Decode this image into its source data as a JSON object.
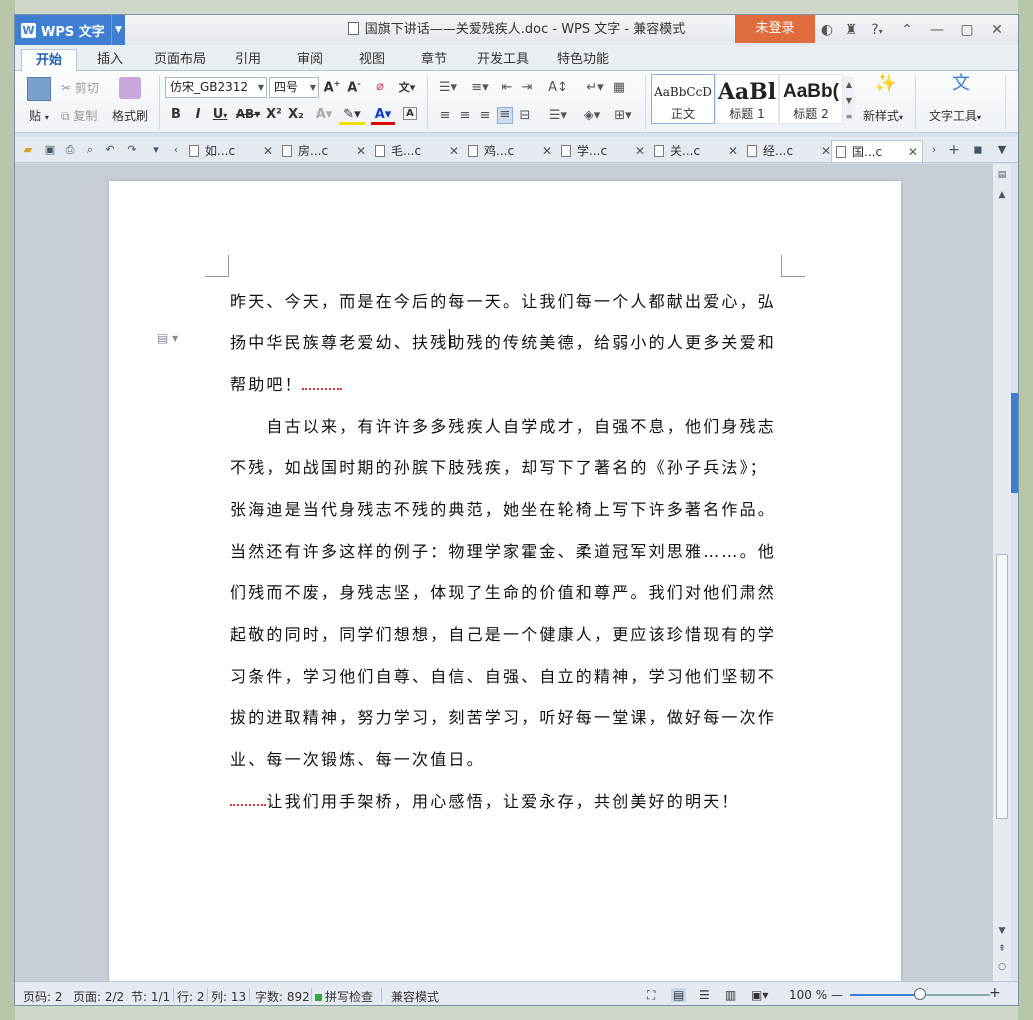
{
  "window": {
    "app_menu_label": "WPS 文字",
    "doc_title": "国旗下讲话——关爱残疾人.doc - WPS 文字 - 兼容模式",
    "login_label": "未登录",
    "help_label": "?"
  },
  "ribbon_tabs": [
    "开始",
    "插入",
    "页面布局",
    "引用",
    "审阅",
    "视图",
    "章节",
    "开发工具",
    "特色功能"
  ],
  "ribbon": {
    "paste_label": "贴",
    "cut_label": "剪切",
    "copy_label": "复制",
    "format_painter_label": "格式刷",
    "font_name": "仿宋_GB2312",
    "font_size": "四号",
    "styles": [
      {
        "sample": "AaBbCcD",
        "name": "正文"
      },
      {
        "sample": "AaBl",
        "name": "标题 1"
      },
      {
        "sample": "AaBb(",
        "name": "标题 2"
      }
    ],
    "new_style_label": "新样式",
    "text_tools_label": "文字工具"
  },
  "doc_tabs": [
    {
      "label": "如...c"
    },
    {
      "label": "房...c"
    },
    {
      "label": "毛...c"
    },
    {
      "label": "鸡...c"
    },
    {
      "label": "学...c"
    },
    {
      "label": "关...c"
    },
    {
      "label": "经...c"
    },
    {
      "label": "国...c"
    }
  ],
  "document": {
    "lines": [
      "昨天、今天，而是在今后的每一天。让我们每一个人都献出爱心，弘",
      "扬中华民族尊老爱幼、扶残助残的传统美德，给弱小的人更多关爱和",
      "帮助吧！",
      "　　自古以来，有许许多多残疾人自学成才，自强不息，他们身残志",
      "不残，如战国时期的孙膑下肢残疾，却写下了著名的《孙子兵法》；",
      "张海迪是当代身残志不残的典范，她坐在轮椅上写下许多著名作品。",
      "当然还有许多这样的例子：物理学家霍金、柔道冠军刘思雅……。他",
      "们残而不废，身残志坚，体现了生命的价值和尊严。我们对他们肃然",
      "起敬的同时，同学们想想，自己是一个健康人，更应该珍惜现有的学",
      "习条件，学习他们自尊、自信、自强、自立的精神，学习他们坚韧不",
      "拔的进取精神，努力学习，刻苦学习，听好每一堂课，做好每一次作",
      "业、每一次锻炼、每一次值日。",
      "　　让我们用手架桥，用心感悟，让爱永存，共创美好的明天！"
    ]
  },
  "status": {
    "page_code": "页码: 2",
    "page": "页面: 2/2",
    "section": "节: 1/1",
    "row": "行: 2",
    "col": "列: 13",
    "word_count": "字数: 892",
    "spell_check": "拼写检查",
    "compat_mode": "兼容模式",
    "zoom": "100 %",
    "zoom_fraction": 0.5
  },
  "colors": {
    "accent": "#3f7fd1",
    "login": "#e06b3f",
    "spell_squiggle": "#dd3333"
  }
}
